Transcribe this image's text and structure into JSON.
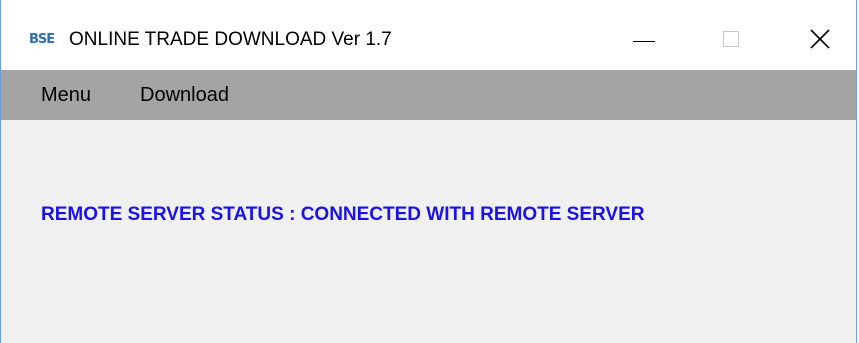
{
  "window": {
    "app_icon_text": "BSE",
    "title": "ONLINE TRADE DOWNLOAD Ver 1.7"
  },
  "menu": {
    "items": [
      {
        "label": "Menu"
      },
      {
        "label": "Download"
      }
    ]
  },
  "main": {
    "status_text": "REMOTE SERVER STATUS : CONNECTED WITH REMOTE SERVER"
  },
  "colors": {
    "status_text": "#1a12e8",
    "menubar_bg": "#a4a4a4",
    "content_bg": "#f0f0f0",
    "icon": "#2f6fba"
  },
  "icons": {
    "app": "bse-logo-icon",
    "minimize": "minimize-icon",
    "maximize": "maximize-icon",
    "close": "close-icon"
  }
}
